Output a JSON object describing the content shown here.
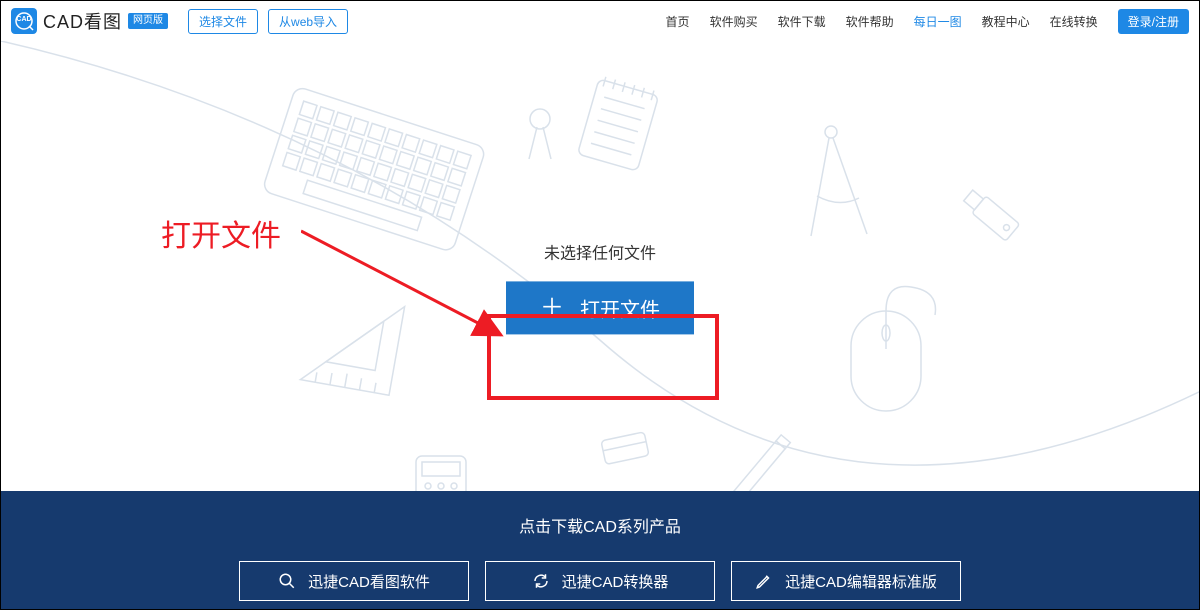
{
  "header": {
    "logo_text": "CAD",
    "brand": "CAD看图",
    "badge": "网页版",
    "select_file_btn": "选择文件",
    "import_web_btn": "从web导入"
  },
  "nav": {
    "items": [
      "首页",
      "软件购买",
      "软件下载",
      "软件帮助",
      "每日一图",
      "教程中心",
      "在线转换"
    ],
    "highlight_index": 4,
    "login": "登录/注册"
  },
  "main": {
    "no_file_text": "未选择任何文件",
    "open_file_btn": "打开文件"
  },
  "annotation": {
    "label": "打开文件"
  },
  "footer": {
    "title": "点击下载CAD系列产品",
    "downloads": [
      {
        "icon": "search",
        "label": "迅捷CAD看图软件"
      },
      {
        "icon": "refresh",
        "label": "迅捷CAD转换器"
      },
      {
        "icon": "pencil",
        "label": "迅捷CAD编辑器标准版"
      }
    ]
  },
  "colors": {
    "primary": "#1e88e5",
    "footer_bg": "#163a6e",
    "annotation": "#ed1c24"
  }
}
